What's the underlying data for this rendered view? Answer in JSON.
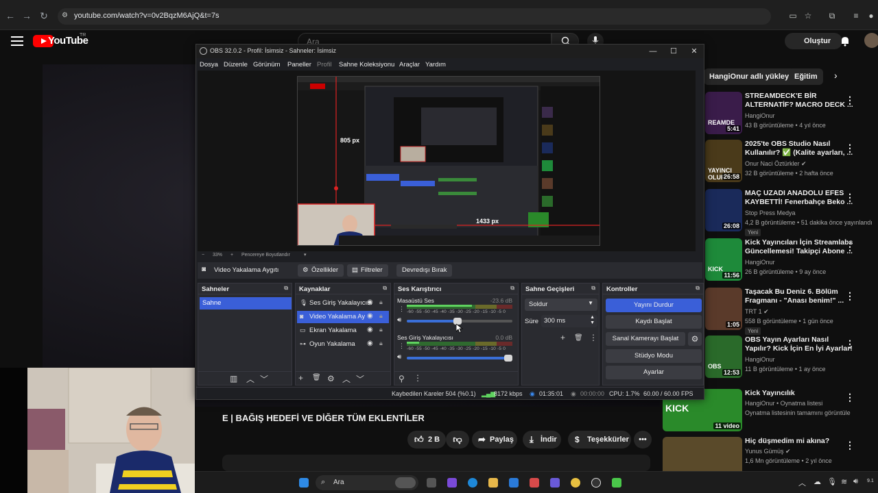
{
  "browser": {
    "url": "youtube.com/watch?v=0v2BqzM6AjQ&t=7s"
  },
  "youtube": {
    "logo_text": "YouTube",
    "logo_superscript": "TR",
    "search_placeholder": "Ara",
    "create_label": "Oluştur",
    "video_title": "E | BAĞIŞ HEDEFİ VE DİĞER TÜM EKLENTİLER",
    "actions": {
      "likes": "2 B",
      "share": "Paylaş",
      "download": "İndir",
      "thanks": "Teşekkürler"
    },
    "chips": [
      "HangiOnur adlı yükleyiciden",
      "Eğitim"
    ],
    "recommendations": [
      {
        "title": "STREAMDECK'E BİR ALTERNATİF? MACRO DECK ...",
        "channel": "HangiOnur",
        "meta": "43 B görüntüleme • 4 yıl önce",
        "duration": "5:41",
        "thumb_text": "REAMDE",
        "thumb_color": "#3a1c4a"
      },
      {
        "title": "2025'te OBS Studio Nasıl Kullanılır? ✅ (Kalite ayarları, ...",
        "channel": "Onur Naci Öztürkler ✔",
        "meta": "32 B görüntüleme • 2 hafta önce",
        "duration": "26:58",
        "thumb_text": "YAYINCI OLUR",
        "thumb_color": "#4a3a1a"
      },
      {
        "title": "MAÇ UZADI ANADOLU EFES KAYBETTİ! Fenerbahçe Beko ...",
        "channel": "Stop Press Medya",
        "meta": "4,2 B görüntüleme • 51 dakika önce yayınlandı",
        "badge": "Yeni",
        "duration": "26:08",
        "thumb_text": "",
        "thumb_color": "#1a2a5a"
      },
      {
        "title": "Kick Yayıncıları İçin Streamlabs Güncellemesi! Takipçi  Abone ...",
        "channel": "HangiOnur",
        "meta": "26 B görüntüleme • 9 ay önce",
        "duration": "11:56",
        "thumb_text": "KICK",
        "thumb_color": "#1e8a3a"
      },
      {
        "title": "Taşacak Bu Deniz 6. Bölüm Fragmanı - \"Anası benim!\" ...",
        "channel": "TRT 1 ✔",
        "meta": "558 B görüntüleme • 1 gün önce",
        "badge": "Yeni",
        "duration": "1:05",
        "thumb_text": "",
        "thumb_color": "#5a3a2a"
      },
      {
        "title": "OBS Yayın Ayarları Nasıl Yapılır? Kick İçin En İyi Ayarlar!",
        "channel": "HangiOnur",
        "meta": "11 B görüntüleme • 1 ay önce",
        "duration": "12:53",
        "thumb_text": "OBS",
        "thumb_color": "#2a6a2a"
      },
      {
        "title": "Kick Yayıncılık",
        "channel": "HangiOnur • Oynatma listesi",
        "meta": "Oynatma listesinin tamamını görüntüle",
        "duration": "11 video",
        "thumb_text": "KICK",
        "thumb_color": "#2a8a2a"
      },
      {
        "title": "Hiç düşmedim mi akına?",
        "channel": "Yunus Gümüş ✔",
        "meta": "1,6 Mn görüntüleme • 2 yıl önce",
        "duration": "",
        "thumb_text": "",
        "thumb_color": "#5a4a2a"
      }
    ]
  },
  "obs": {
    "title": "OBS 32.0.2 - Profil: İsimsiz - Sahneler: İsimsiz",
    "menu": [
      "Dosya",
      "Düzenle",
      "Görünüm",
      "Paneller",
      "Profil",
      "Sahne Koleksiyonu",
      "Araçlar",
      "Yardım"
    ],
    "preview": {
      "height_label": "805 px",
      "width_label": "1433 px"
    },
    "zoom": {
      "minus": "−",
      "value": "33%",
      "plus": "+",
      "fit_label": "Pencereye Boyutlandır"
    },
    "source_toolbar": {
      "source_name": "Video Yakalama Aygıtı",
      "properties": "Özellikler",
      "filters": "Filtreler",
      "deactivate": "Devredışı Bırak"
    },
    "docks": {
      "scenes": {
        "title": "Sahneler",
        "items": [
          "Sahne"
        ]
      },
      "sources": {
        "title": "Kaynaklar",
        "items": [
          {
            "name": "Ses Giriş Yakalayıcısı",
            "icon": "microphone-icon"
          },
          {
            "name": "Video Yakalama Ay",
            "icon": "camera-icon"
          },
          {
            "name": "Ekran Yakalama",
            "icon": "monitor-icon"
          },
          {
            "name": "Oyun Yakalama",
            "icon": "gamepad-icon"
          }
        ]
      },
      "mixer": {
        "title": "Ses Karıştırıcı",
        "tick_labels": "-60 -55 -50 -45 -40 -35 -30 -25 -20 -15 -10 -5 0",
        "channels": [
          {
            "name": "Masaüstü Ses",
            "db": "-23.6 dB",
            "level": 0.62,
            "volume": 0.48
          },
          {
            "name": "Ses Giriş Yakalayıcısı",
            "db": "0.0 dB",
            "level": 0.12,
            "volume": 1.0
          }
        ]
      },
      "transitions": {
        "title": "Sahne Geçişleri",
        "selected": "Soldur",
        "duration_label": "Süre",
        "duration_value": "300 ms"
      },
      "controls": {
        "title": "Kontroller",
        "buttons": [
          "Yayını Durdur",
          "Kaydı Başlat",
          "Sanal Kamerayı Başlat",
          "Stüdyo Modu",
          "Ayarlar"
        ]
      }
    },
    "status": {
      "dropped": "Kaybedilen Kareler 504 (%0.1)",
      "bitrate": "8172 kbps",
      "stream_time": "01:35:01",
      "rec_time": "00:00:00",
      "cpu": "CPU: 1.7%",
      "fps": "60.00 / 60.00 FPS"
    }
  },
  "taskbar": {
    "search_label": "Ara",
    "clock": "9.1"
  },
  "colors": {
    "obs_accent": "#3a5fd8",
    "yt_red": "#ff0000"
  }
}
